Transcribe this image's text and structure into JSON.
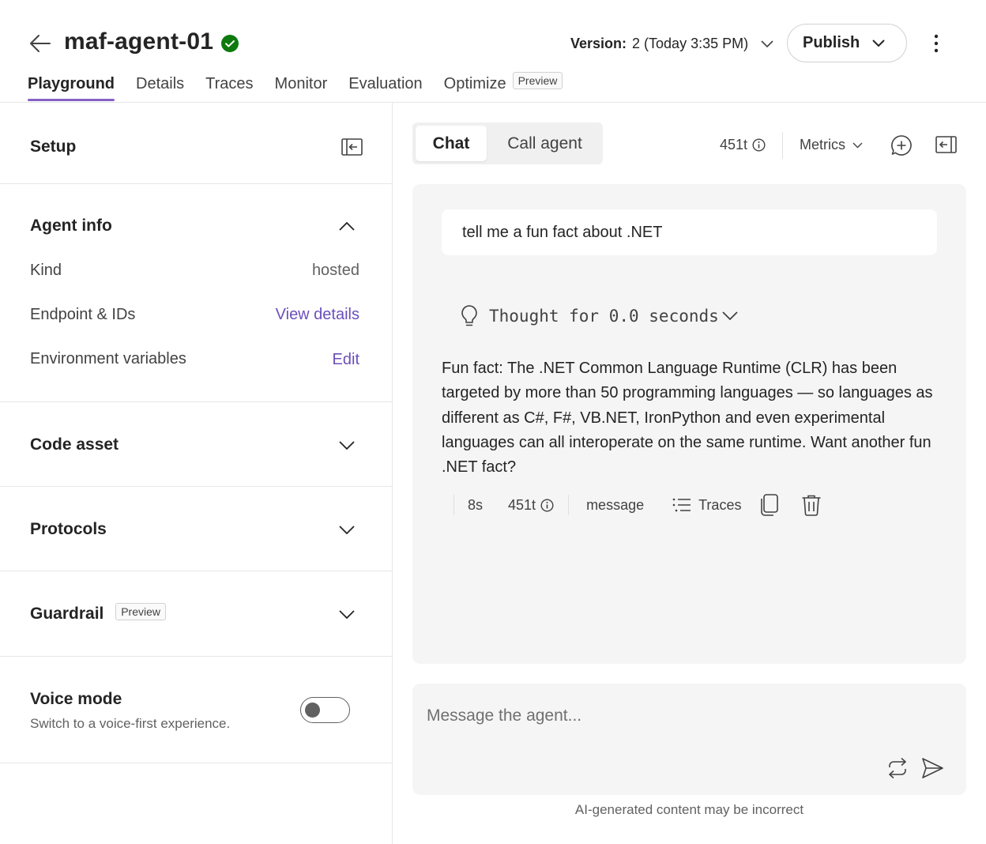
{
  "header": {
    "agent_name": "maf-agent-01",
    "version_label": "Version:",
    "version_value": "2 (Today 3:35 PM)",
    "publish_label": "Publish"
  },
  "tabs": [
    {
      "label": "Playground",
      "active": true
    },
    {
      "label": "Details"
    },
    {
      "label": "Traces"
    },
    {
      "label": "Monitor"
    },
    {
      "label": "Evaluation"
    },
    {
      "label": "Optimize",
      "badge": "Preview"
    }
  ],
  "setup": {
    "title": "Setup",
    "agent_info": {
      "title": "Agent info",
      "rows": [
        {
          "label": "Kind",
          "value": "hosted"
        },
        {
          "label": "Endpoint & IDs",
          "link": "View details"
        },
        {
          "label": "Environment variables",
          "link": "Edit"
        }
      ]
    },
    "code_asset": {
      "title": "Code asset"
    },
    "protocols": {
      "title": "Protocols"
    },
    "guardrail": {
      "title": "Guardrail",
      "badge": "Preview"
    },
    "voice_mode": {
      "title": "Voice mode",
      "subtitle": "Switch to a voice-first experience.",
      "enabled": false
    }
  },
  "chat": {
    "tabs": [
      {
        "label": "Chat",
        "active": true
      },
      {
        "label": "Call agent"
      }
    ],
    "token_count": "451t",
    "metrics_label": "Metrics",
    "user_message": "tell me a fun fact about .NET",
    "thought_label": "Thought for 0.0 seconds",
    "assistant_message": "Fun fact: The .NET Common Language Runtime (CLR) has been targeted by more than 50 programming languages — so languages as different as C#, F#, VB.NET, IronPython and even experimental languages can all interoperate on the same runtime. Want another fun .NET fact?",
    "message_meta": {
      "duration": "8s",
      "tokens": "451t",
      "type": "message",
      "traces_label": "Traces"
    },
    "input_placeholder": "Message the agent...",
    "disclaimer": "AI-generated content may be incorrect"
  },
  "colors": {
    "accent": "#8661c5",
    "link": "#6b4fbb",
    "success": "#0e7a0d",
    "chat_bg": "#f5f5f5"
  },
  "icons": [
    "back-arrow-icon",
    "success-check-icon",
    "chevron-down-icon",
    "more-vertical-icon",
    "collapse-panel-icon",
    "chevron-up-icon",
    "info-icon",
    "new-chat-icon",
    "panel-icon",
    "lightbulb-icon",
    "list-icon",
    "copy-icon",
    "delete-icon",
    "refresh-icon",
    "send-icon"
  ]
}
